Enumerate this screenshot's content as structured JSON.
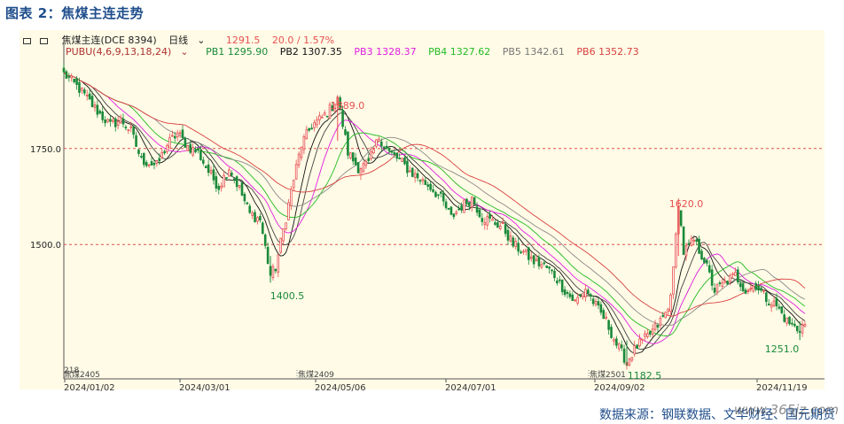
{
  "title": "图表 2：焦煤主连走势",
  "header": {
    "symbol": "焦煤主连(DCE 8394)",
    "period": "日线",
    "last": "1291.5",
    "change": "20.0 / 1.57%",
    "indicator": "PUBU(4,6,9,13,18,24)",
    "pb": [
      {
        "label": "PB1 1295.90",
        "color": "#111111"
      },
      {
        "label": "PB2 1307.35",
        "color": "#111111"
      },
      {
        "label": "PB3 1328.37",
        "color": "#e01ee0"
      },
      {
        "label": "PB4 1327.62",
        "color": "#22bb22"
      },
      {
        "label": "PB5 1342.61",
        "color": "#777777"
      },
      {
        "label": "PB6 1352.73",
        "color": "#d94040"
      }
    ]
  },
  "source": "数据来源：钢联数据、文华财经、国元期货",
  "watermark": "www.365jz.com",
  "colors": {
    "up": "#e85050",
    "down": "#1a8a3a",
    "grid": "#e05050",
    "axis": "#555555"
  },
  "chart_data": {
    "type": "candlestick",
    "y_ticks": [
      1750.0,
      1500.0
    ],
    "y_tick_labels": [
      "1750.0",
      "1500.0"
    ],
    "ylim": [
      1150,
      1980
    ],
    "x_tick_labels": [
      "2024/01/02",
      "2024/03/01",
      "2024/05/06",
      "2024/07/01",
      "2024/09/02",
      "2024/11/19"
    ],
    "contract_labels": [
      "焦煤2405",
      "焦煤2409",
      "焦煤2501"
    ],
    "axis_fragment": "218",
    "annotations": [
      {
        "text": "1889.0",
        "value": 1889.0,
        "kind": "high",
        "color": "#e85050"
      },
      {
        "text": "1400.5",
        "value": 1400.5,
        "kind": "low",
        "color": "#1a8a3a"
      },
      {
        "text": "1620.0",
        "value": 1620.0,
        "kind": "high",
        "color": "#e85050"
      },
      {
        "text": "1182.5",
        "value": 1182.5,
        "kind": "low",
        "color": "#1a8a3a"
      },
      {
        "text": "1251.0",
        "value": 1251.0,
        "kind": "low",
        "color": "#1a8a3a"
      }
    ],
    "anchors": [
      [
        0,
        1945
      ],
      [
        6,
        1905
      ],
      [
        12,
        1855
      ],
      [
        18,
        1810
      ],
      [
        22,
        1825
      ],
      [
        26,
        1795
      ],
      [
        30,
        1720
      ],
      [
        36,
        1705
      ],
      [
        40,
        1760
      ],
      [
        44,
        1790
      ],
      [
        48,
        1755
      ],
      [
        52,
        1740
      ],
      [
        56,
        1690
      ],
      [
        60,
        1650
      ],
      [
        64,
        1700
      ],
      [
        68,
        1645
      ],
      [
        72,
        1580
      ],
      [
        76,
        1565
      ],
      [
        80,
        1420
      ],
      [
        82,
        1440
      ],
      [
        86,
        1570
      ],
      [
        88,
        1640
      ],
      [
        92,
        1760
      ],
      [
        96,
        1810
      ],
      [
        100,
        1830
      ],
      [
        104,
        1860
      ],
      [
        106,
        1885
      ],
      [
        110,
        1740
      ],
      [
        114,
        1700
      ],
      [
        118,
        1710
      ],
      [
        122,
        1780
      ],
      [
        126,
        1740
      ],
      [
        130,
        1720
      ],
      [
        134,
        1690
      ],
      [
        138,
        1670
      ],
      [
        142,
        1650
      ],
      [
        146,
        1620
      ],
      [
        150,
        1570
      ],
      [
        154,
        1600
      ],
      [
        158,
        1620
      ],
      [
        162,
        1570
      ],
      [
        166,
        1560
      ],
      [
        170,
        1545
      ],
      [
        174,
        1500
      ],
      [
        178,
        1480
      ],
      [
        182,
        1455
      ],
      [
        186,
        1445
      ],
      [
        190,
        1420
      ],
      [
        194,
        1380
      ],
      [
        198,
        1350
      ],
      [
        202,
        1385
      ],
      [
        206,
        1340
      ],
      [
        210,
        1300
      ],
      [
        214,
        1240
      ],
      [
        218,
        1195
      ],
      [
        222,
        1235
      ],
      [
        226,
        1260
      ],
      [
        230,
        1290
      ],
      [
        234,
        1330
      ],
      [
        236,
        1430
      ],
      [
        238,
        1610
      ],
      [
        240,
        1480
      ],
      [
        244,
        1510
      ],
      [
        248,
        1460
      ],
      [
        252,
        1380
      ],
      [
        256,
        1400
      ],
      [
        260,
        1420
      ],
      [
        264,
        1380
      ],
      [
        268,
        1395
      ],
      [
        272,
        1360
      ],
      [
        276,
        1340
      ],
      [
        280,
        1300
      ],
      [
        284,
        1280
      ],
      [
        287,
        1292
      ]
    ],
    "n_bars": 288
  }
}
